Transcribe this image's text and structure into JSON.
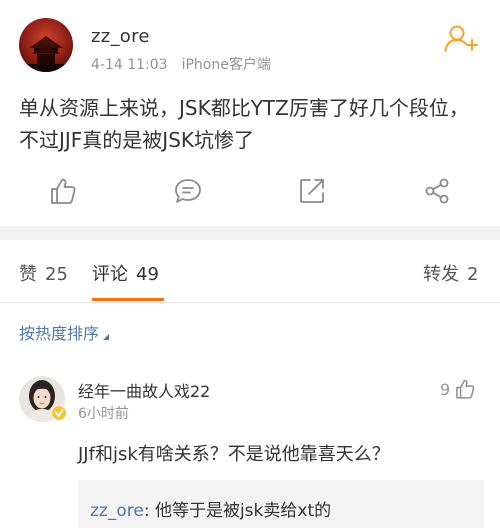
{
  "post": {
    "username": "zz_ore",
    "date": "4-14 11:03",
    "client": "iPhone客户端",
    "text": "单从资源上来说，JSK都比YTZ厉害了好几个段位，不过JJF真的是被JSK坑惨了",
    "avatar_icon": "avatar-red-pagoda",
    "follow_icon": "add-user-icon",
    "accent_color": "#f5a623"
  },
  "actions": {
    "like_icon": "thumb-up-icon",
    "comment_icon": "comment-icon",
    "share_icon": "share-out-icon",
    "more_share_icon": "share-nodes-icon"
  },
  "tabs": {
    "like_label": "赞",
    "like_count": "25",
    "comment_label": "评论",
    "comment_count": "49",
    "repost_label": "转发",
    "repost_count": "2",
    "active_color": "#e8541e",
    "underline_color": "#f86e0f"
  },
  "sort": {
    "label": "按热度排序"
  },
  "comments": [
    {
      "username": "经年一曲故人戏22",
      "time": "6小时前",
      "likes": "9",
      "text": "JJf和jsk有啥关系？不是说他靠喜天么？",
      "reply_author": "zz_ore",
      "reply_text": ": 他等于是被jsk卖给xt的",
      "verified_color": "#f6c23a"
    }
  ],
  "colors": {
    "link": "#4f78ab",
    "meta": "#939393",
    "icon": "#8a8a8a"
  }
}
